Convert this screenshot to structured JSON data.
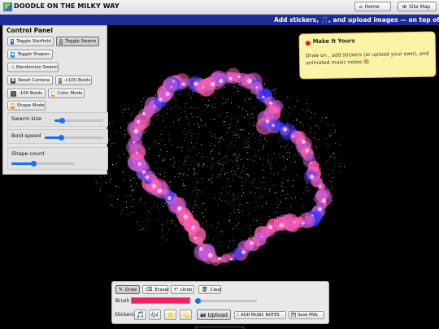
{
  "app": {
    "title": "DOODLE ON THE MILKY WAY",
    "nav": {
      "home_label": "Home",
      "sitemap_label": "Site Map"
    }
  },
  "banner": {
    "text": "Add stickers, 🎵, and upload images — on top of your genera"
  },
  "control_panel": {
    "title": "Control Panel",
    "buttons": {
      "toggle_starfield": "Toggle Starfield",
      "toggle_swarm": "Toggle Swarm",
      "toggle_shapes": "Toggle Shapes",
      "randomize_swarm": "Randomize Swarm",
      "reset_camera": "Reset Camera",
      "plus_100_boids": "+100 Boids",
      "minus_100_boids": "-100 Boids",
      "color_mode": "Color Mode",
      "shape_mode": "Shape Mode"
    },
    "sliders": {
      "swarm_size": {
        "label": "Swarm size",
        "value_fraction": 0.15
      },
      "boid_speed": {
        "label": "Boid speed",
        "value_fraction": 0.28
      },
      "shape_count": {
        "label": "Shape count",
        "value_fraction": 0.35
      }
    }
  },
  "info_card": {
    "title": "Make It Yours",
    "body": "Draw on , add stickers (or upload your own), and animated music notes.🎨"
  },
  "toolbar": {
    "draw_label": "Draw",
    "eraser_label": "Eraser",
    "undo_label": "Undo",
    "clear_label": "Clear",
    "brush_label": "Brush",
    "brush_color": "#ee2266",
    "brush_size_fraction": 0.04,
    "stickers_label": "Stickers",
    "stickers": [
      "🎵",
      "🎶",
      "⭐",
      "💫"
    ],
    "upload_label": "Upload",
    "add_music_notes_label": "ADD MUSIC NOTES",
    "save_png_label": "Save PNG"
  },
  "colors": {
    "banner_bg": "#1e2c95",
    "accent": "#1a73e8",
    "info_card_bg": "#fdf3a6",
    "blob_pink": "#ff5fb0",
    "blob_blue": "#3a3aff"
  }
}
